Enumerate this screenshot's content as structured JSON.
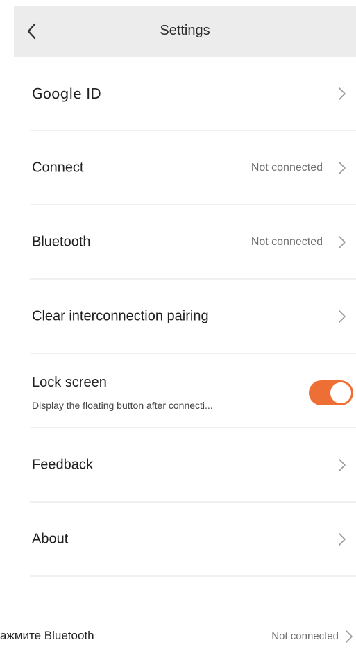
{
  "header": {
    "title": "Settings",
    "back_icon": "chevron-left-icon"
  },
  "settings": {
    "google_id": {
      "label": "Google ID"
    },
    "connect": {
      "label": "Connect",
      "status": "Not connected"
    },
    "bluetooth": {
      "label": "Bluetooth",
      "status": "Not connected"
    },
    "clear_pairing": {
      "label": "Clear interconnection pairing"
    },
    "lock_screen": {
      "label": "Lock screen",
      "description": "Display the floating button after connecti...",
      "enabled": true
    },
    "feedback": {
      "label": "Feedback"
    },
    "about": {
      "label": "About"
    }
  },
  "footer": {
    "caption": "ажмите Bluetooth",
    "status": "Not connected"
  },
  "colors": {
    "accent": "#ee6f36",
    "header_bg": "#ececec",
    "divider": "#f0f0f0",
    "secondary_text": "#707070"
  },
  "icons": {
    "row_chevron": "chevron-right-icon"
  }
}
